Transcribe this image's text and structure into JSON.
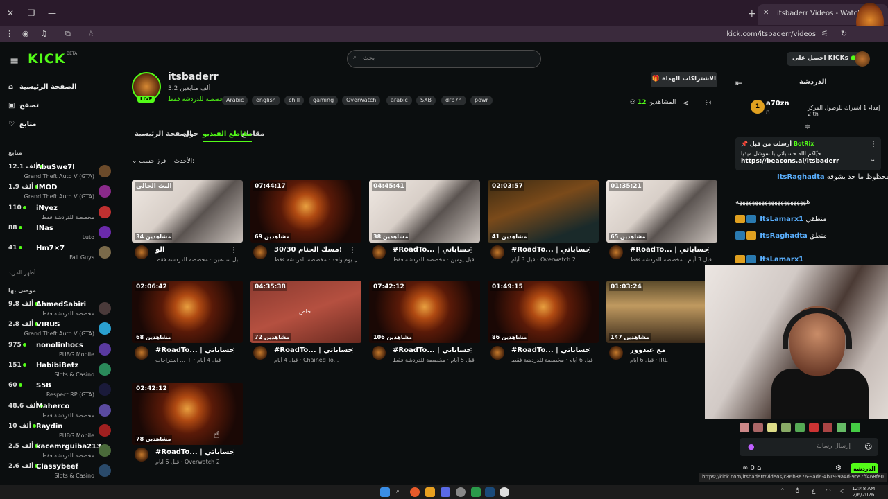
{
  "browser": {
    "tab_title": "itsbaderr Videos - Watch On-D",
    "url": "kick.com/itsbaderr/videos",
    "status_url": "https://kick.com/itsbaderr/videos/c86b3e76-9ad6-4b19-9a4d-9ce7ff468fe0"
  },
  "header": {
    "logo": "KICK",
    "beta": "BETA",
    "search_placeholder": "بحث",
    "kicks_button": "احصل على KICKs"
  },
  "sidebar": {
    "nav": [
      {
        "label": "الصفحة الرئيسية",
        "icon": "home-icon"
      },
      {
        "label": "تصفح",
        "icon": "browse-icon"
      },
      {
        "label": "متابع",
        "icon": "heart-icon"
      }
    ],
    "following_title": "متابع",
    "following": [
      {
        "count": "12.1 ألف",
        "name": "AbuSwe7l",
        "category": "Grand Theft Auto V (GTA)",
        "color": "#6b4a2a"
      },
      {
        "count": "1.9 ألف",
        "name": "IMOD",
        "category": "Grand Theft Auto V (GTA)",
        "color": "#8a2a8a"
      },
      {
        "count": "110",
        "name": "iNyez",
        "category": "مخصصة للدردشة فقط",
        "color": "#c03030"
      },
      {
        "count": "88",
        "name": "INas",
        "category": "Luto",
        "color": "#6a2aaa"
      },
      {
        "count": "41",
        "name": "Hm7×7",
        "category": "Fall Guys",
        "color": "#7a6a4a"
      }
    ],
    "show_more": "أظهر المزيد",
    "recommended_title": "موصى بها",
    "recommended": [
      {
        "count": "9.8 ألف",
        "name": "AhmedSabiri",
        "category": "مخصصة للدردشة فقط",
        "color": "#4a3a3a"
      },
      {
        "count": "2.8 ألف",
        "name": "VIRUS",
        "category": "Grand Theft Auto V (GTA)",
        "color": "#2aa0d0"
      },
      {
        "count": "975",
        "name": "nonolinhocs",
        "category": "PUBG Mobile",
        "color": "#5a3aa0"
      },
      {
        "count": "151",
        "name": "HabibiBetz",
        "category": "Slots & Casino",
        "color": "#2a8a5a"
      },
      {
        "count": "60",
        "name": "S5B",
        "category": "Respect RP (GTA)",
        "color": "#1a1a3a"
      },
      {
        "count": "48.6 ألف",
        "name": "Maherco",
        "category": "مخصصة للدردشة فقط",
        "color": "#5a4aa0"
      },
      {
        "count": "10 ألف",
        "name": "Raydin",
        "category": "PUBG Mobile",
        "color": "#a02020"
      },
      {
        "count": "2.5 ألف",
        "name": "kacemrguiba213",
        "category": "مخصصة للدردشة فقط",
        "color": "#4a6a3a"
      },
      {
        "count": "2.6 ألف",
        "name": "Classybeef",
        "category": "Slots & Casino",
        "color": "#2a4a6a"
      }
    ]
  },
  "channel": {
    "name": "itsbaderr",
    "followers": "3.2 ألف متابعين",
    "category": "مخصصة للدردشة فقط",
    "live_badge": "LIVE",
    "tags": [
      "Arabic",
      "english",
      "chill",
      "gaming",
      "Overwatch",
      "arabic",
      "SXB",
      "drb7h",
      "powr"
    ],
    "subscribe_button": "الاشتراكات الهداة",
    "viewers_label": "المشاهدين",
    "viewers_count": "12"
  },
  "page_tabs": [
    "مقاطع",
    "مقاطع الفيديو",
    "حول",
    "الصفحة الرئيسية"
  ],
  "sort": {
    "label": "فرز حسب:",
    "value": "الأحدث"
  },
  "videos": [
    {
      "duration": "البث الحالي",
      "views": "34 مشاهدين",
      "title": "الو",
      "meta": "قبل ساعتين · مخصصة للدردشة فقط",
      "thumb": "room-th"
    },
    {
      "duration": "07:44:17",
      "views": "69 مشاهدين",
      "title": "30/30 مسك الختام!",
      "meta": "قبل يوم واحد · مخصصة للدردشة فقط",
      "thumb": "lion-th"
    },
    {
      "duration": "04:45:41",
      "views": "38 مشاهدين",
      "title": "#RoadTo... | إحساباتي",
      "meta": "قبل يومين · مخصصة للدردشة فقط",
      "thumb": "room-th"
    },
    {
      "duration": "02:03:57",
      "views": "41 مشاهدين",
      "title": "#RoadTo... | إحساباتي",
      "meta": "قبل 3 أيام · Overwatch 2",
      "thumb": "game-th"
    },
    {
      "duration": "01:35:21",
      "views": "65 مشاهدين",
      "title": "#RoadTo... | إحساباتي",
      "meta": "قبل 3 أيام · مخصصة للدردشة فقط",
      "thumb": "room-th"
    },
    {
      "duration": "02:06:42",
      "views": "68 مشاهدين",
      "title": "#RoadTo... | إحساباتي",
      "meta": "قبل 4 أيام · + ... استراحات",
      "thumb": "lion-th"
    },
    {
      "duration": "04:35:38",
      "views": "72 مشاهدين",
      "title": "#RoadTo... | إحساباتي",
      "meta": "قبل 4 أيام · Chained To...",
      "thumb": "pink-th",
      "overlay": "خاص"
    },
    {
      "duration": "07:42:12",
      "views": "106 مشاهدين",
      "title": "#RoadTo... | إحساباتي",
      "meta": "قبل 5 أيام · مخصصة للدردشة فقط",
      "thumb": "lion-th"
    },
    {
      "duration": "01:49:15",
      "views": "86 مشاهدين",
      "title": "#RoadTo... | إحساباتي",
      "meta": "قبل 6 أيام · مخصصة للدردشة فقط",
      "thumb": "lion-th"
    },
    {
      "duration": "01:03:24",
      "views": "147 مشاهدين",
      "title": "مع عبدوور",
      "meta": "قبل 6 أيام · IRL",
      "thumb": "street-th"
    },
    {
      "duration": "02:42:12",
      "views": "78 مشاهدين",
      "title": "#RoadTo... | إحساباتي",
      "meta": "قبل 6 أيام · Overwatch 2",
      "thumb": "lion-th"
    }
  ],
  "chat": {
    "title": "الدردشة",
    "top_gifter": {
      "name": "a70zn",
      "count": "8",
      "text": "إهداء 1 اشتراك للوصول المركز 2 th"
    },
    "pinned": {
      "by": "أرسلت من قبل",
      "bot": "BotRix",
      "text": "حيّاكم الله حساباتي بالسوشل ميديا",
      "link": "https://beacons.ai/itsbaderr"
    },
    "messages": [
      {
        "user": "ItsRaghadta",
        "text": "معليك: محظوظ ما حد يشوفه"
      },
      {
        "user": "",
        "text": "ههههههههههههههههههههههه"
      },
      {
        "user": "ItsLamarx1",
        "text": "منطقي"
      },
      {
        "user": "ItsRaghadta",
        "text": "منطق"
      },
      {
        "user": "ItsLamarx1",
        "text": ""
      }
    ],
    "input_placeholder": "إرسال رسالة",
    "send_button": "الدردشة",
    "bottom_count": "0"
  },
  "taskbar": {
    "time": "12:48 AM",
    "date": "2/6/2026",
    "lang": "ع"
  }
}
